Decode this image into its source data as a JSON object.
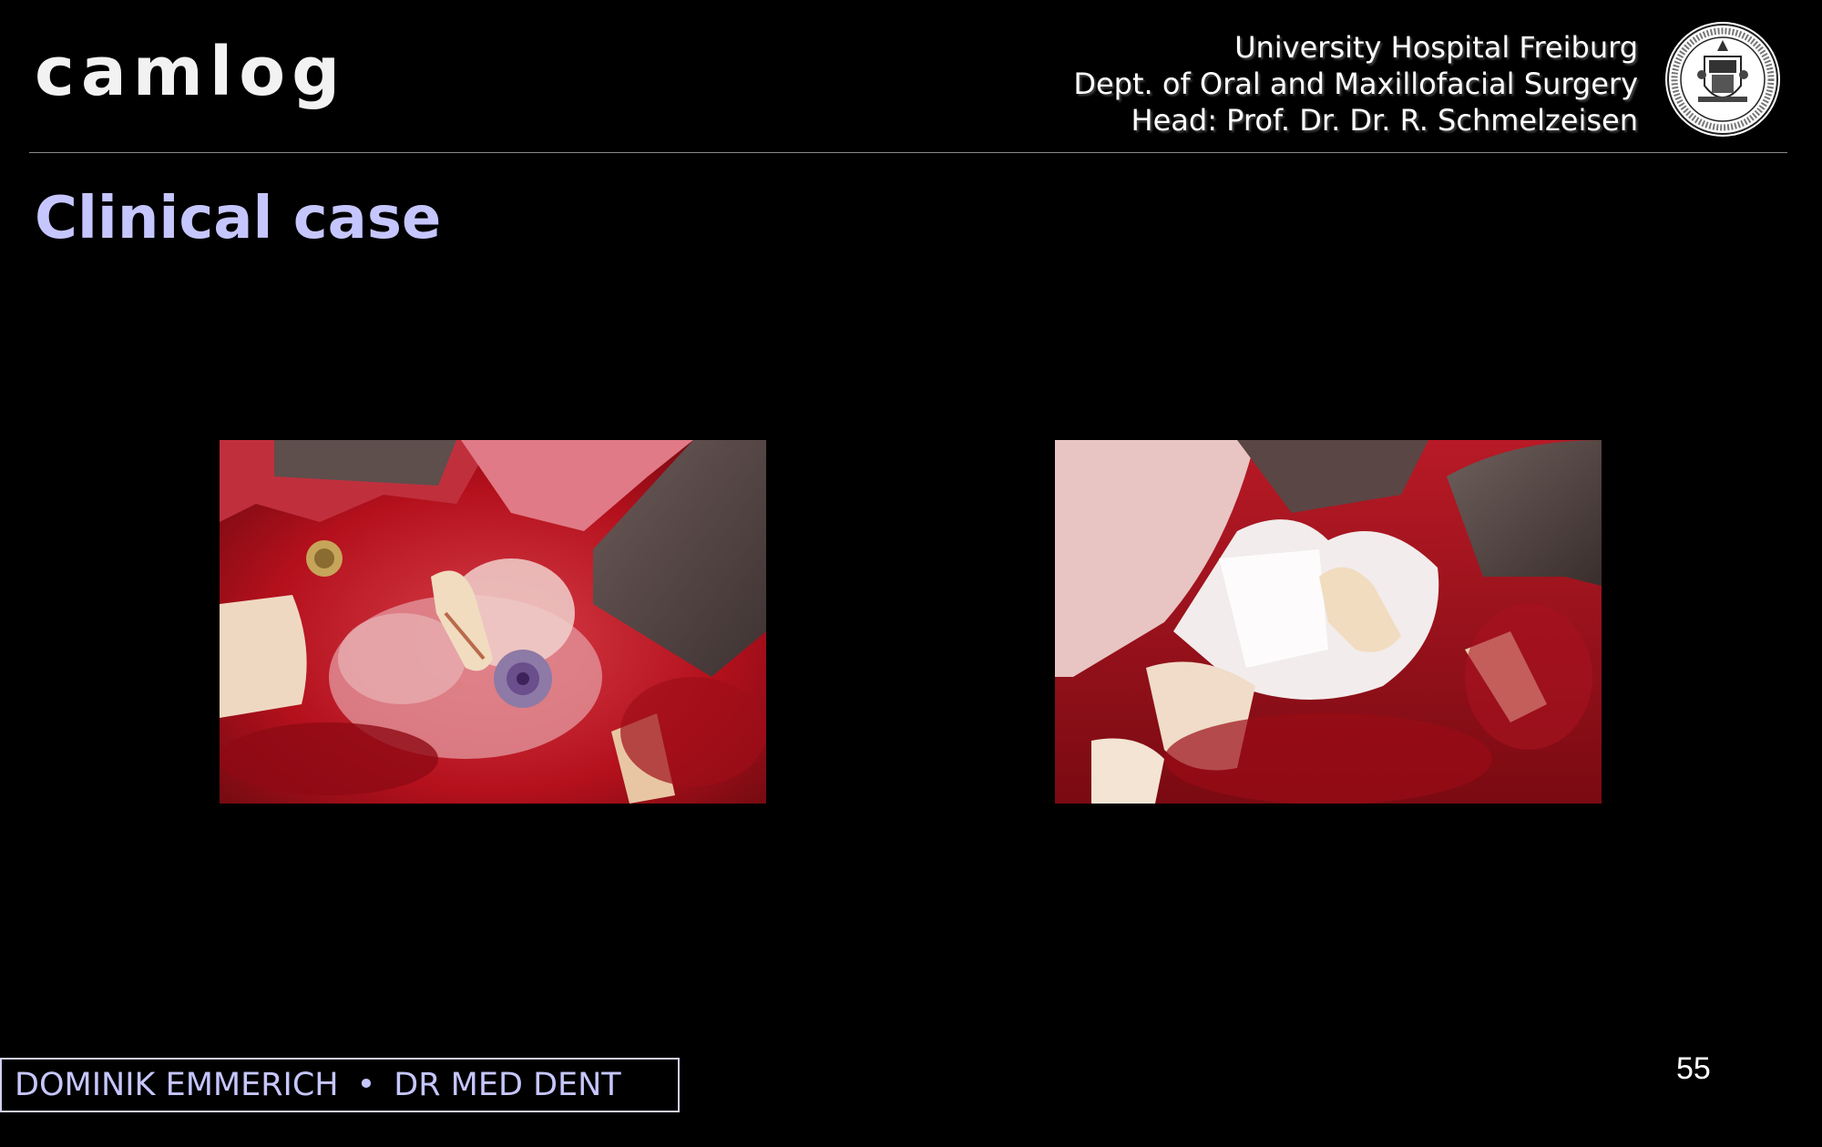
{
  "logo": {
    "text": "camlog"
  },
  "header": {
    "lines": [
      "University Hospital Freiburg",
      "Dept. of Oral and Maxillofacial Surgery",
      "Head: Prof. Dr. Dr. R. Schmelzeisen"
    ],
    "seal_icon": "university-seal-icon"
  },
  "title": "Clinical case",
  "footer": {
    "name": "DOMINIK EMMERICH",
    "separator": "•",
    "degree": "DR MED DENT"
  },
  "page_number": "55",
  "colors": {
    "background": "#000000",
    "title": "#c6c6ff",
    "footer_text": "#c6c6ff",
    "header_text": "#ffffff"
  }
}
